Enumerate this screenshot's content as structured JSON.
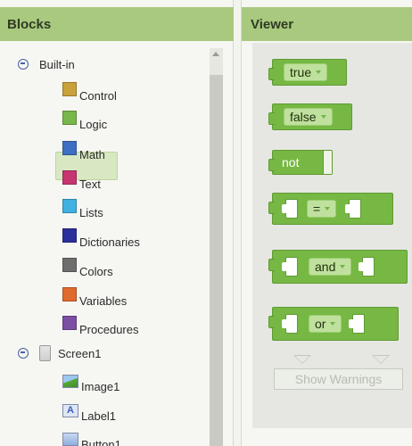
{
  "blocks_panel": {
    "header": "Blocks",
    "builtin": {
      "label": "Built-in",
      "items": [
        {
          "label": "Control",
          "color": "#c9a13b"
        },
        {
          "label": "Logic",
          "color": "#77b84a"
        },
        {
          "label": "Math",
          "color": "#3d6fc2"
        },
        {
          "label": "Text",
          "color": "#c73570"
        },
        {
          "label": "Lists",
          "color": "#3fb1e0"
        },
        {
          "label": "Dictionaries",
          "color": "#2b2f9b"
        },
        {
          "label": "Colors",
          "color": "#6e6e6e"
        },
        {
          "label": "Variables",
          "color": "#e06a2e"
        },
        {
          "label": "Procedures",
          "color": "#7b4fa3"
        }
      ]
    },
    "screen": {
      "label": "Screen1",
      "components": [
        {
          "label": "Image1",
          "icon": "image-icon"
        },
        {
          "label": "Label1",
          "icon": "label-icon",
          "glyph": "A"
        },
        {
          "label": "Button1",
          "icon": "button-icon"
        }
      ]
    }
  },
  "viewer_panel": {
    "header": "Viewer",
    "blocks": {
      "true": "true",
      "false": "false",
      "not": "not",
      "equals": "=",
      "and": "and",
      "or": "or"
    },
    "show_warnings": "Show Warnings"
  },
  "colors": {
    "header_green": "#a9c97f",
    "logic_block": "#76b843"
  }
}
